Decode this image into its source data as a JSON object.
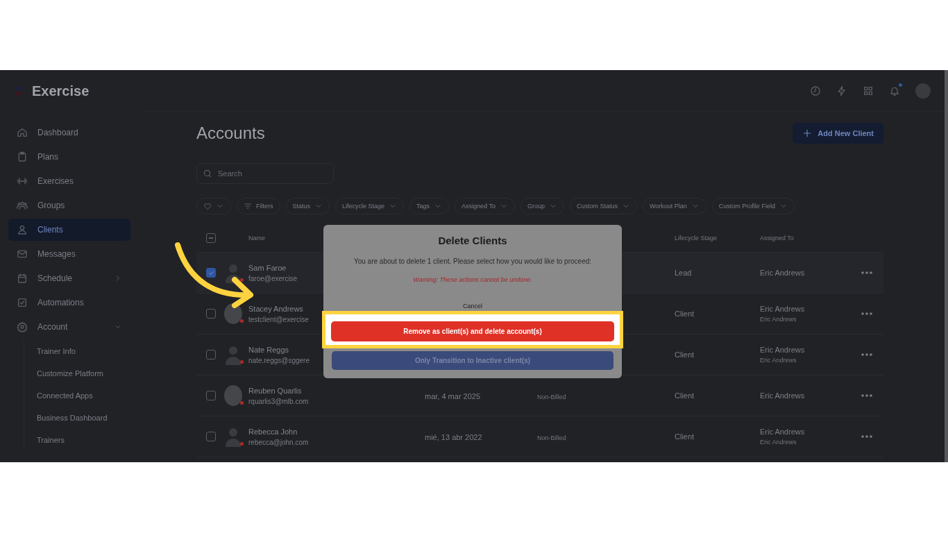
{
  "app": {
    "name": "Exercise"
  },
  "topbar": {
    "notification_dot": true
  },
  "sidebar": {
    "items": [
      {
        "label": "Dashboard",
        "selected": false
      },
      {
        "label": "Plans",
        "selected": false
      },
      {
        "label": "Exercises",
        "selected": false
      },
      {
        "label": "Groups",
        "selected": false
      },
      {
        "label": "Clients",
        "selected": true
      },
      {
        "label": "Messages",
        "selected": false
      },
      {
        "label": "Schedule",
        "selected": false,
        "expanded": false
      },
      {
        "label": "Automations",
        "selected": false
      },
      {
        "label": "Account",
        "selected": false,
        "expanded": true,
        "children": [
          {
            "label": "Trainer Info",
            "selected": false
          },
          {
            "label": "Customize Platform",
            "selected": false
          },
          {
            "label": "Connected Apps",
            "selected": false
          },
          {
            "label": "Business Dashboard",
            "selected": false
          },
          {
            "label": "Trainers",
            "selected": false
          }
        ]
      }
    ]
  },
  "page": {
    "title": "Accounts",
    "add_button": "Add New Client",
    "search": {
      "placeholder": "Search"
    }
  },
  "filters": [
    {
      "kind": "favorite"
    },
    {
      "kind": "filter",
      "label": "Filters"
    },
    {
      "kind": "dropdown",
      "label": "Status"
    },
    {
      "kind": "dropdown",
      "label": "Lifecycle Stage"
    },
    {
      "kind": "dropdown",
      "label": "Tags"
    },
    {
      "kind": "dropdown",
      "label": "Assigned To"
    },
    {
      "kind": "dropdown",
      "label": "Group"
    },
    {
      "kind": "dropdown",
      "label": "Custom Status"
    },
    {
      "kind": "dropdown",
      "label": "Workout Plan"
    },
    {
      "kind": "dropdown",
      "label": "Custom Profile Field"
    }
  ],
  "table": {
    "header_indeterminate": true,
    "columns": [
      "Name",
      "Lifecycle Stage",
      "Assigned To"
    ],
    "rows": [
      {
        "selected": true,
        "has_photo": false,
        "name": "Sam Faroe",
        "email": "faroe@exercise",
        "lifecycle": "Lead",
        "assigned": "Eric Andrews"
      },
      {
        "selected": false,
        "has_photo": true,
        "name": "Stacey Andrews",
        "email": "testclient@exercise",
        "lifecycle": "Client",
        "assigned": "Eric Andrews",
        "assigned_sub": "Eric Andrews"
      },
      {
        "selected": false,
        "has_photo": false,
        "name": "Nate Reggs",
        "email": "nate.reggs@sggere",
        "lifecycle": "Client",
        "assigned": "Eric Andrews",
        "assigned_sub": "Eric Andrews"
      },
      {
        "selected": false,
        "has_photo": true,
        "name": "Reuben Quarlis",
        "email": "rquarlis3@mlb.com",
        "date": "mar, 4 mar 2025",
        "billing": "Non-Billed",
        "lifecycle": "Client",
        "assigned": "Eric Andrews"
      },
      {
        "selected": false,
        "has_photo": false,
        "name": "Rebecca John",
        "email": "rebecca@john.com",
        "date": "mié, 13 abr 2022",
        "billing": "Non-Billed",
        "lifecycle": "Client",
        "assigned": "Eric Andrews",
        "assigned_sub": "Eric Andrews"
      }
    ]
  },
  "dialog": {
    "title": "Delete Clients",
    "message": "You are about to delete 1 client. Please select how you would like to proceed:",
    "warning": "Warning: These actions cannot be undone.",
    "cancel": "Cancel",
    "buttons": [
      {
        "label": "Remove as client(s) and delete account(s)",
        "kind": "danger",
        "highlighted": true
      },
      {
        "label": "Only Transition to Inactive client(s)",
        "kind": "primary",
        "highlighted": false
      }
    ]
  }
}
